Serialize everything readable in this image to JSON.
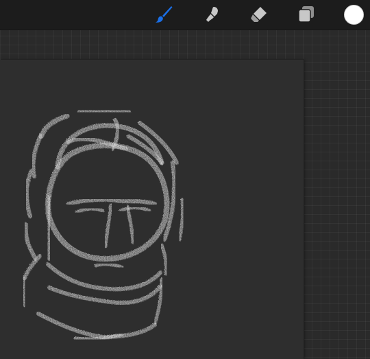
{
  "toolbar": {
    "tools": [
      {
        "name": "brush",
        "icon": "brush-icon",
        "active": true
      },
      {
        "name": "smudge",
        "icon": "smudge-icon",
        "active": false
      },
      {
        "name": "eraser",
        "icon": "eraser-icon",
        "active": false
      },
      {
        "name": "layers",
        "icon": "layers-icon",
        "active": false
      }
    ],
    "color_swatch": "#ffffff"
  },
  "colors": {
    "accent": "#1a6fe8",
    "toolbar_bg": "#1c1c1c",
    "workspace_bg": "#2a2a2a",
    "canvas_bg": "#2e2e2e",
    "stroke": "#d8d8d8",
    "icon_inactive": "#c8c8c8"
  }
}
